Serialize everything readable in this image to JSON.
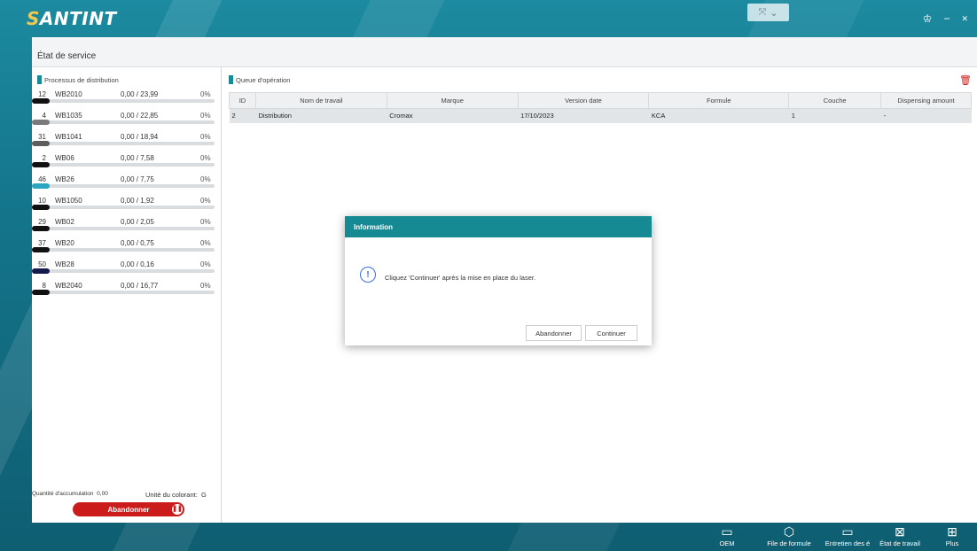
{
  "app": {
    "logo_prefix": "S",
    "logo_rest": "ANTINT"
  },
  "window": {
    "title": "État de service"
  },
  "left_panel": {
    "header": "Processus de distribution",
    "rows": [
      {
        "num": "12",
        "code": "WB2010",
        "amount": "0,00 / 23,99",
        "pct": "0%",
        "color": "#111111",
        "fill": 0
      },
      {
        "num": "4",
        "code": "WB1035",
        "amount": "0,00 / 22,85",
        "pct": "0%",
        "color": "#7a7a7a",
        "fill": 0
      },
      {
        "num": "31",
        "code": "WB1041",
        "amount": "0,00 / 18,94",
        "pct": "0%",
        "color": "#5e5e5e",
        "fill": 0
      },
      {
        "num": "2",
        "code": "WB06",
        "amount": "0,00 / 7,58",
        "pct": "0%",
        "color": "#111111",
        "fill": 0
      },
      {
        "num": "46",
        "code": "WB26",
        "amount": "0,00 / 7,75",
        "pct": "0%",
        "color": "#2aa6c0",
        "fill": 0
      },
      {
        "num": "10",
        "code": "WB1050",
        "amount": "0,00 / 1,92",
        "pct": "0%",
        "color": "#111111",
        "fill": 0
      },
      {
        "num": "29",
        "code": "WB02",
        "amount": "0,00 / 2,05",
        "pct": "0%",
        "color": "#111111",
        "fill": 0
      },
      {
        "num": "37",
        "code": "WB20",
        "amount": "0,00 / 0,75",
        "pct": "0%",
        "color": "#111111",
        "fill": 0
      },
      {
        "num": "50",
        "code": "WB28",
        "amount": "0,00 / 0,16",
        "pct": "0%",
        "color": "#141a4a",
        "fill": 0
      },
      {
        "num": "8",
        "code": "WB2040",
        "amount": "0,00 / 16,77",
        "pct": "0%",
        "color": "#111111",
        "fill": 0
      }
    ],
    "accum_label": "Quantité d'accumulation",
    "accum_value": "0,00",
    "unit_label": "Unité du colorant:",
    "unit_value": "G",
    "abort_button": "Abandonner"
  },
  "right_panel": {
    "header": "Queue d'opération",
    "columns": [
      "ID",
      "Nom de travail",
      "Marque",
      "Version date",
      "Formule",
      "Couche",
      "Dispensing amount"
    ],
    "rows": [
      [
        "2",
        "Distribution",
        "Cromax",
        "17/10/2023",
        "KCA",
        "1",
        "-"
      ]
    ]
  },
  "dialog": {
    "title": "Information",
    "icon": "info-icon",
    "message": "Cliquez 'Continuer' après la mise en place du laser.",
    "cancel_label": "Abandonner",
    "ok_label": "Continuer"
  },
  "taskbar": {
    "items": [
      {
        "label": "OEM",
        "icon": "oem-icon"
      },
      {
        "label": "File de formule",
        "icon": "cube-icon"
      },
      {
        "label": "Entretien des é",
        "icon": "monitor-icon"
      },
      {
        "label": "État de travail",
        "icon": "chart-icon"
      },
      {
        "label": "Plus",
        "icon": "grid-icon"
      }
    ]
  },
  "colors": {
    "accent": "#168a93",
    "danger": "#cc1b1b"
  }
}
